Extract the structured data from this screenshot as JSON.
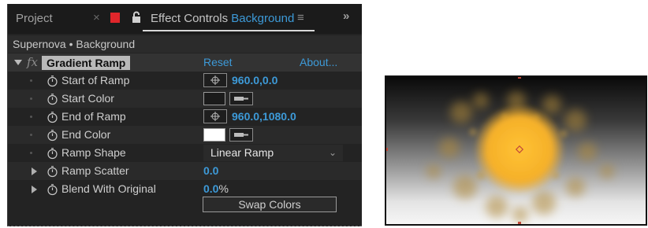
{
  "tabs": {
    "project": "Project",
    "close_glyph": "×",
    "effect_controls_prefix": "Effect Controls",
    "effect_controls_layer": "Background",
    "menu_glyph": "≡",
    "overflow_glyph": "»"
  },
  "layer_title": "Supernova • Background",
  "effect": {
    "fx_glyph": "fx",
    "name": "Gradient Ramp",
    "reset": "Reset",
    "about": "About..."
  },
  "properties": {
    "start_of_ramp": {
      "label": "Start of Ramp",
      "value": "960.0,0.0"
    },
    "start_color": {
      "label": "Start Color",
      "color": "#1b1b1b"
    },
    "end_of_ramp": {
      "label": "End of Ramp",
      "value": "960.0,1080.0"
    },
    "end_color": {
      "label": "End Color",
      "color": "#ffffff"
    },
    "ramp_shape": {
      "label": "Ramp Shape",
      "value": "Linear Ramp"
    },
    "ramp_scatter": {
      "label": "Ramp Scatter",
      "value": "0.0"
    },
    "blend_with_original": {
      "label": "Blend With Original",
      "value": "0.0",
      "unit": "%"
    }
  },
  "swap_colors": "Swap Colors",
  "colors": {
    "accent": "#3d9ad8",
    "panel_bg": "#232323",
    "tab_bg": "#1b1b1b",
    "red_label": "#e0262b",
    "glow": "#f5b02a"
  },
  "icons": [
    "lock-icon",
    "stopwatch-icon",
    "target-icon",
    "eyedropper-icon",
    "chevron-down-icon",
    "anchor-point-icon"
  ]
}
